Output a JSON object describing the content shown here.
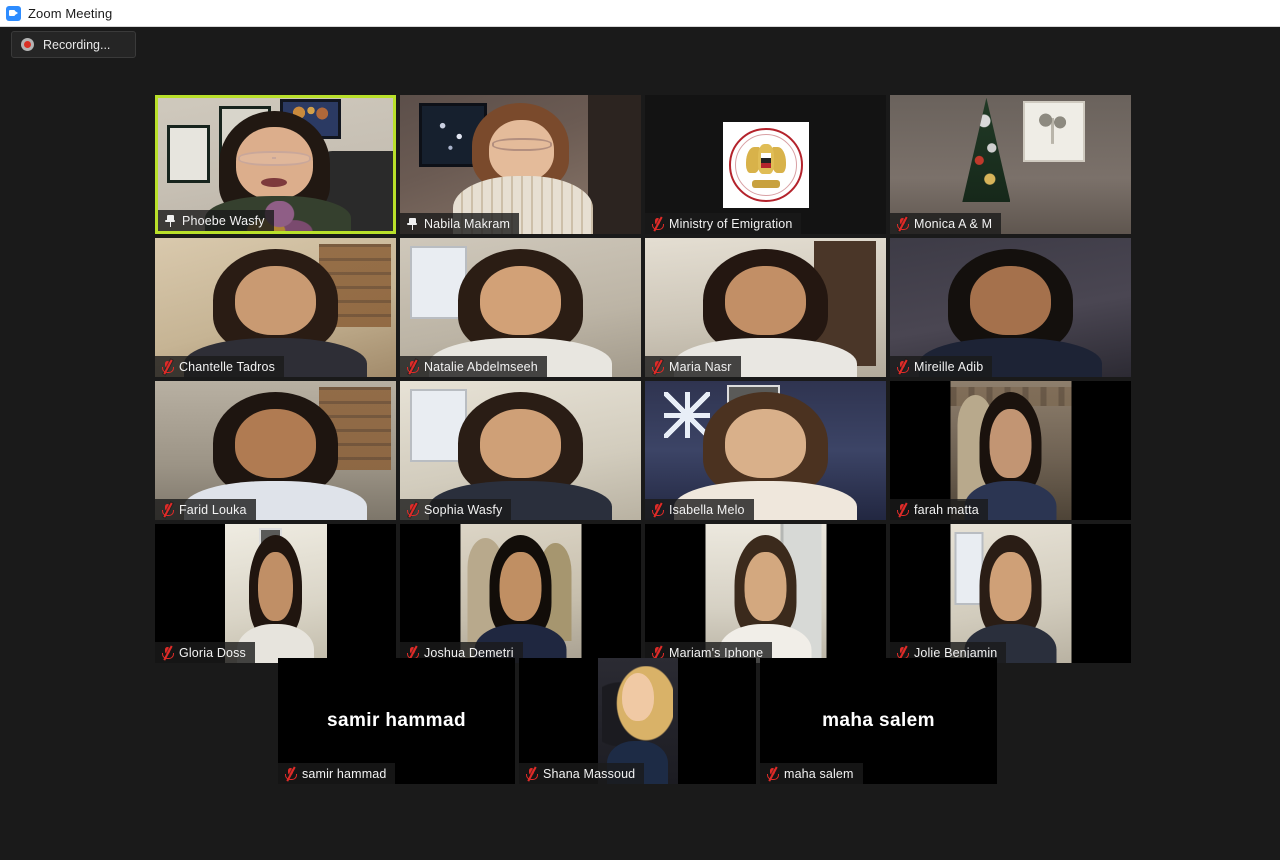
{
  "window": {
    "title": "Zoom Meeting",
    "app_icon": "zoom-camera-icon"
  },
  "toolbar": {
    "recording_label": "Recording...",
    "recording_icon": "record-dot-icon"
  },
  "colors": {
    "page_background": "#1a1a1a",
    "active_speaker_border": "#b9e02a",
    "mute_icon": "#e02b28",
    "titlebar_background": "#ffffff",
    "badge_background": "rgba(26,26,26,0.80)"
  },
  "gallery": {
    "rows": [
      {
        "tiles": [
          {
            "name": "Phoebe Wasfy",
            "status_icon": "pin-icon",
            "active_speaker": true,
            "has_video": true,
            "video_style": "v-phoebe",
            "orientation": "fill"
          },
          {
            "name": "Nabila Makram",
            "status_icon": "pin-icon",
            "active_speaker": false,
            "has_video": true,
            "video_style": "v-nabila",
            "orientation": "fill"
          },
          {
            "name": "Ministry of Emigration",
            "status_icon": "mic-muted-icon",
            "active_speaker": false,
            "has_video": true,
            "video_style": "v-ministry",
            "orientation": "fill"
          },
          {
            "name": "Monica A & M",
            "status_icon": "mic-muted-icon",
            "active_speaker": false,
            "has_video": true,
            "video_style": "v-monica",
            "orientation": "fill"
          }
        ]
      },
      {
        "tiles": [
          {
            "name": "Chantelle Tadros",
            "status_icon": "mic-muted-icon",
            "active_speaker": false,
            "has_video": true,
            "video_style": "room-a",
            "orientation": "fill"
          },
          {
            "name": "Natalie Abdelmseeh",
            "status_icon": "mic-muted-icon",
            "active_speaker": false,
            "has_video": true,
            "video_style": "room-b",
            "orientation": "fill"
          },
          {
            "name": "Maria Nasr",
            "status_icon": "mic-muted-icon",
            "active_speaker": false,
            "has_video": true,
            "video_style": "room-c",
            "orientation": "fill"
          },
          {
            "name": "Mireille Adib",
            "status_icon": "mic-muted-icon",
            "active_speaker": false,
            "has_video": true,
            "video_style": "room-d",
            "orientation": "fill"
          }
        ]
      },
      {
        "tiles": [
          {
            "name": "Farid Louka",
            "status_icon": "mic-muted-icon",
            "active_speaker": false,
            "has_video": true,
            "video_style": "room-e",
            "orientation": "fill"
          },
          {
            "name": "Sophia Wasfy",
            "status_icon": "mic-muted-icon",
            "active_speaker": false,
            "has_video": true,
            "video_style": "room-f",
            "orientation": "fill"
          },
          {
            "name": "Isabella Melo",
            "status_icon": "mic-muted-icon",
            "active_speaker": false,
            "has_video": true,
            "video_style": "room-g",
            "orientation": "fill"
          },
          {
            "name": "farah matta",
            "status_icon": "mic-muted-icon",
            "active_speaker": false,
            "has_video": true,
            "video_style": "room-i",
            "orientation": "portrait-wide"
          }
        ]
      },
      {
        "tiles": [
          {
            "name": "Gloria Doss",
            "status_icon": "mic-muted-icon",
            "active_speaker": false,
            "has_video": true,
            "video_style": "room-h",
            "orientation": "portrait"
          },
          {
            "name": "Joshua Demetri",
            "status_icon": "mic-muted-icon",
            "active_speaker": false,
            "has_video": true,
            "video_style": "room-j",
            "orientation": "portrait-wide"
          },
          {
            "name": "Mariam's Iphone",
            "status_icon": "mic-muted-icon",
            "active_speaker": false,
            "has_video": true,
            "video_style": "room-k",
            "orientation": "portrait-wide"
          },
          {
            "name": "Jolie Benjamin",
            "status_icon": "mic-muted-icon",
            "active_speaker": false,
            "has_video": true,
            "video_style": "room-f",
            "orientation": "portrait-wide"
          }
        ]
      }
    ],
    "bottom_row": {
      "tiles": [
        {
          "name": "samir hammad",
          "status_icon": "mic-muted-icon",
          "has_video": false,
          "display_name": "samir hammad"
        },
        {
          "name": "Shana Massoud",
          "status_icon": "mic-muted-icon",
          "has_video": true,
          "orientation": "portrait-narrow"
        },
        {
          "name": "maha  salem",
          "status_icon": "mic-muted-icon",
          "has_video": false,
          "display_name": "maha  salem"
        }
      ]
    }
  }
}
